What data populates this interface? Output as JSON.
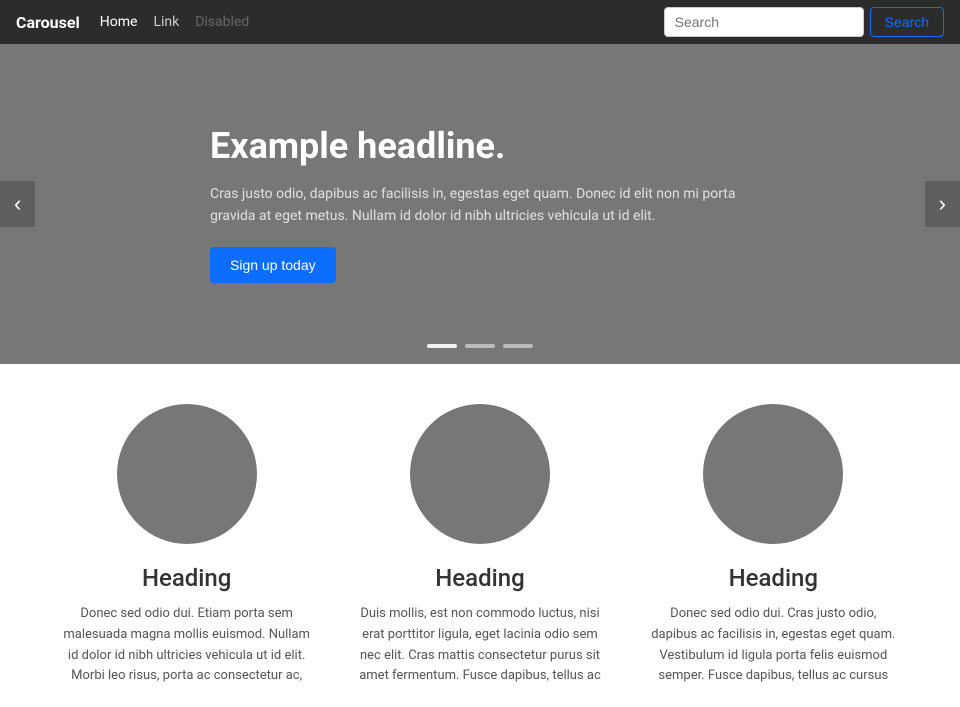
{
  "navbar": {
    "brand": "Carousel",
    "links": [
      {
        "label": "Home",
        "state": "active"
      },
      {
        "label": "Link",
        "state": "normal"
      },
      {
        "label": "Disabled",
        "state": "disabled"
      }
    ],
    "search": {
      "placeholder": "Search",
      "button_label": "Search"
    }
  },
  "carousel": {
    "title": "Example headline.",
    "text": "Cras justo odio, dapibus ac facilisis in, egestas eget quam. Donec id elit non mi porta gravida at eget metus. Nullam id dolor id nibh ultricies vehicula ut id elit.",
    "button_label": "Sign up today",
    "prev_label": "‹",
    "next_label": "›",
    "indicators": [
      {
        "active": true
      },
      {
        "active": false
      },
      {
        "active": false
      }
    ]
  },
  "features": [
    {
      "heading": "Heading",
      "text": "Donec sed odio dui. Etiam porta sem malesuada magna mollis euismod. Nullam id dolor id nibh ultricies vehicula ut id elit. Morbi leo risus, porta ac consectetur ac,"
    },
    {
      "heading": "Heading",
      "text": "Duis mollis, est non commodo luctus, nisi erat porttitor ligula, eget lacinia odio sem nec elit. Cras mattis consectetur purus sit amet fermentum. Fusce dapibus, tellus ac"
    },
    {
      "heading": "Heading",
      "text": "Donec sed odio dui. Cras justo odio, dapibus ac facilisis in, egestas eget quam. Vestibulum id ligula porta felis euismod semper. Fusce dapibus, tellus ac cursus"
    }
  ]
}
